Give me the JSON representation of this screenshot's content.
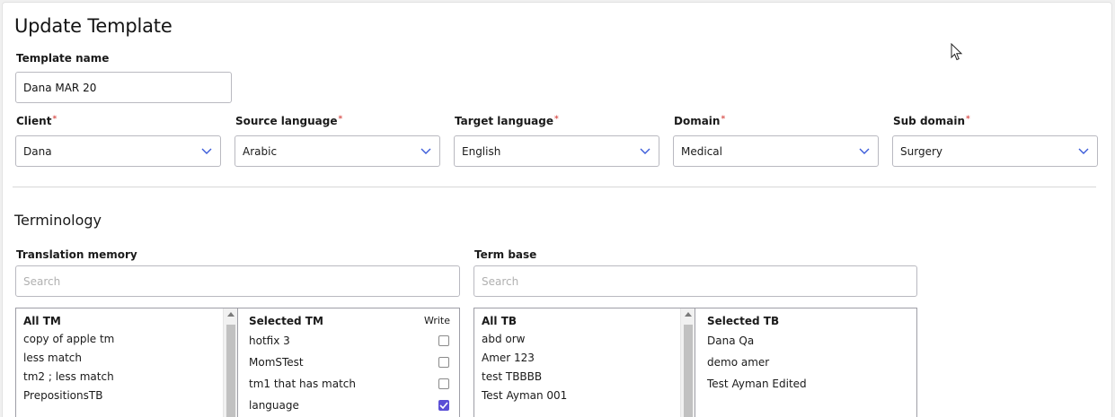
{
  "page": {
    "title": "Update Template",
    "template_name_label": "Template name",
    "template_name_value": "Dana MAR 20"
  },
  "fields": {
    "client": {
      "label": "Client",
      "value": "Dana"
    },
    "source_language": {
      "label": "Source language",
      "value": "Arabic"
    },
    "target_language": {
      "label": "Target language",
      "value": "English"
    },
    "domain": {
      "label": "Domain",
      "value": "Medical"
    },
    "sub_domain": {
      "label": "Sub domain",
      "value": "Surgery"
    },
    "required_mark": "*"
  },
  "terminology": {
    "section_title": "Terminology",
    "tm": {
      "label": "Translation memory",
      "search_placeholder": "Search",
      "all_header": "All TM",
      "all_items": [
        "copy of apple tm",
        "less match",
        "tm2 ; less match",
        "PrepositionsTB"
      ],
      "selected_header": "Selected TM",
      "write_header": "Write",
      "selected_items": [
        {
          "name": "hotfix 3",
          "write": false
        },
        {
          "name": "MomSTest",
          "write": false
        },
        {
          "name": "tm1 that has match",
          "write": false
        },
        {
          "name": "language",
          "write": true
        }
      ]
    },
    "tb": {
      "label": "Term base",
      "search_placeholder": "Search",
      "all_header": "All TB",
      "all_items": [
        "abd orw",
        "Amer 123",
        "test TBBBB",
        "Test Ayman 001"
      ],
      "selected_header": "Selected TB",
      "selected_items": [
        "Dana Qa",
        "demo amer",
        "Test Ayman Edited"
      ]
    }
  },
  "colors": {
    "accent_checkbox": "#5b4fd6",
    "chevron": "#3a5bd9",
    "required": "#d9534f"
  }
}
